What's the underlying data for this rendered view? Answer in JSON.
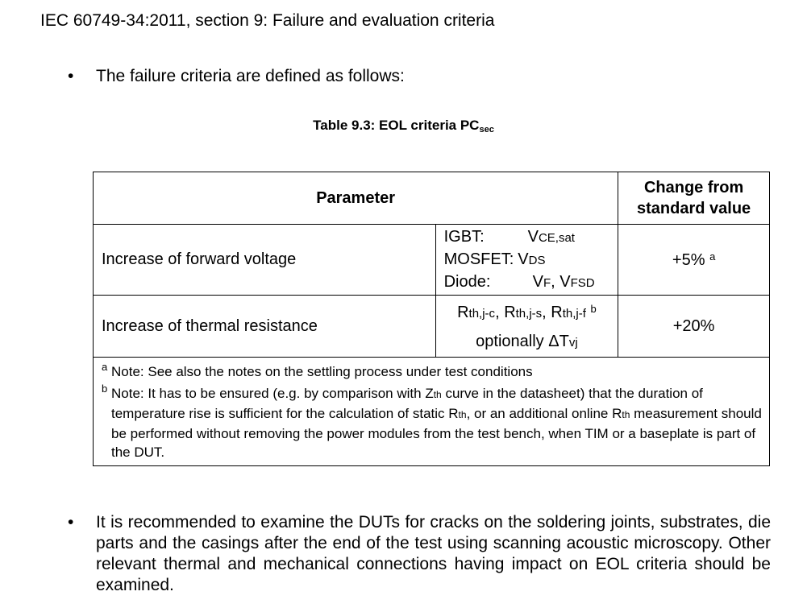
{
  "heading": "IEC 60749-34:2011, section 9: Failure and evaluation criteria",
  "bullet_symbol": "•",
  "bullet1": "The failure criteria are defined as follows:",
  "table": {
    "caption_main": "Table 9.3: EOL criteria PC",
    "caption_sub": "sec",
    "header_parameter": "Parameter",
    "header_change_line1": "Change from",
    "header_change_line2": "standard value",
    "row_forward_voltage": {
      "parameter": "Increase of forward voltage",
      "igbt_label": "IGBT:",
      "igbt_symbol": "V",
      "igbt_sub": "CE,sat",
      "mosfet_label": "MOSFET:",
      "mosfet_symbol": "V",
      "mosfet_sub": "DS",
      "diode_label": "Diode:",
      "diode_symbol1": "V",
      "diode_sub1": "F",
      "diode_sep": ", ",
      "diode_symbol2": "V",
      "diode_sub2": "FSD",
      "change": "+5%",
      "change_mark": "a"
    },
    "row_thermal_resistance": {
      "parameter": "Increase of thermal resistance",
      "r1": "R",
      "r1_sub": "th,j-c",
      "sep1": ", ",
      "r2": "R",
      "r2_sub": "th,j-s",
      "sep2": ", ",
      "r3": "R",
      "r3_sub": "th,j-f",
      "mark": "b",
      "optional_text": "optionally ΔT",
      "optional_sub": "vj",
      "change": "+20%"
    },
    "note_a_mark": "a",
    "note_a": "Note: See also the notes on the settling process under test conditions",
    "note_b_mark": "b",
    "note_b_part1": "Note: It has to be ensured (e.g. by comparison with Z",
    "note_b_sub1": "th",
    "note_b_part2": " curve in the datasheet) that the duration of temperature rise is sufficient for the calculation of static R",
    "note_b_sub2": "th",
    "note_b_part3": ", or an additional online R",
    "note_b_sub3": "th",
    "note_b_part4": " measurement should be performed without removing the power modules from the test bench, when TIM or a baseplate is part of the DUT."
  },
  "bullet2": "It is recommended to examine the DUTs for cracks on the soldering joints, substrates, die parts and the casings after the end of the test using scanning acoustic microscopy. Other relevant thermal and mechanical connections having impact on EOL criteria should be examined."
}
